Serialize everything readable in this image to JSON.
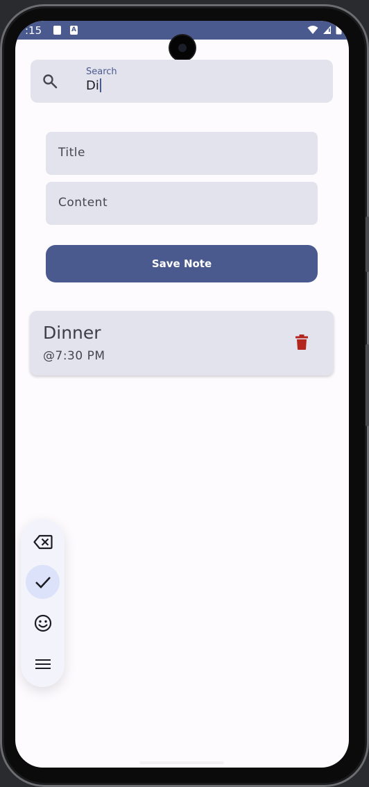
{
  "status_bar": {
    "time": ":15",
    "notification_icons": [
      "sim-card-icon",
      "a-icon"
    ],
    "system_icons": [
      "wifi-icon",
      "signal-icon",
      "battery-icon"
    ],
    "notification_a": "A"
  },
  "search": {
    "label": "Search",
    "value": "Di"
  },
  "form": {
    "title_placeholder": "Title",
    "content_placeholder": "Content",
    "save_label": "Save Note"
  },
  "notes": [
    {
      "title": "Dinner",
      "content": "@7:30 PM"
    }
  ],
  "keyboard_toolbar": {
    "items": [
      "backspace-icon",
      "check-icon",
      "emoji-icon",
      "menu-icon"
    ],
    "active": "check-icon"
  },
  "colors": {
    "primary": "#4a5a8f",
    "surface": "#e2e3ec",
    "background": "#fdfbfe",
    "delete": "#b3261e"
  }
}
